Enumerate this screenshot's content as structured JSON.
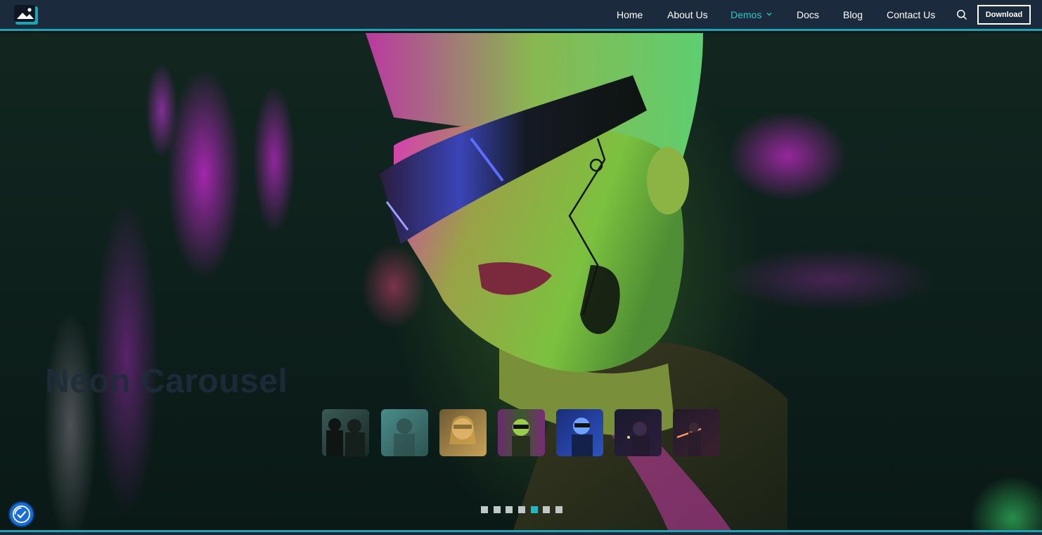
{
  "nav": {
    "items": [
      {
        "label": "Home"
      },
      {
        "label": "About Us"
      },
      {
        "label": "Demos"
      },
      {
        "label": "Docs"
      },
      {
        "label": "Blog"
      },
      {
        "label": "Contact Us"
      }
    ],
    "active_item": "Demos",
    "download_label": "Download",
    "icons": {
      "logo": "image-logo-icon",
      "search": "search-icon",
      "dropdown": "chevron-down-icon"
    }
  },
  "hero": {
    "title": "Neon Carousel",
    "thumbnail_count": 7,
    "pagination": {
      "count": 7,
      "active_index": 4
    }
  },
  "accessibility": {
    "icon": "accessibility-icon"
  },
  "colors": {
    "navbar_bg": "#1b2a3c",
    "accent": "#1fa3b3",
    "active_link": "#2ec6c9",
    "active_dot": "#1fb8c4"
  }
}
